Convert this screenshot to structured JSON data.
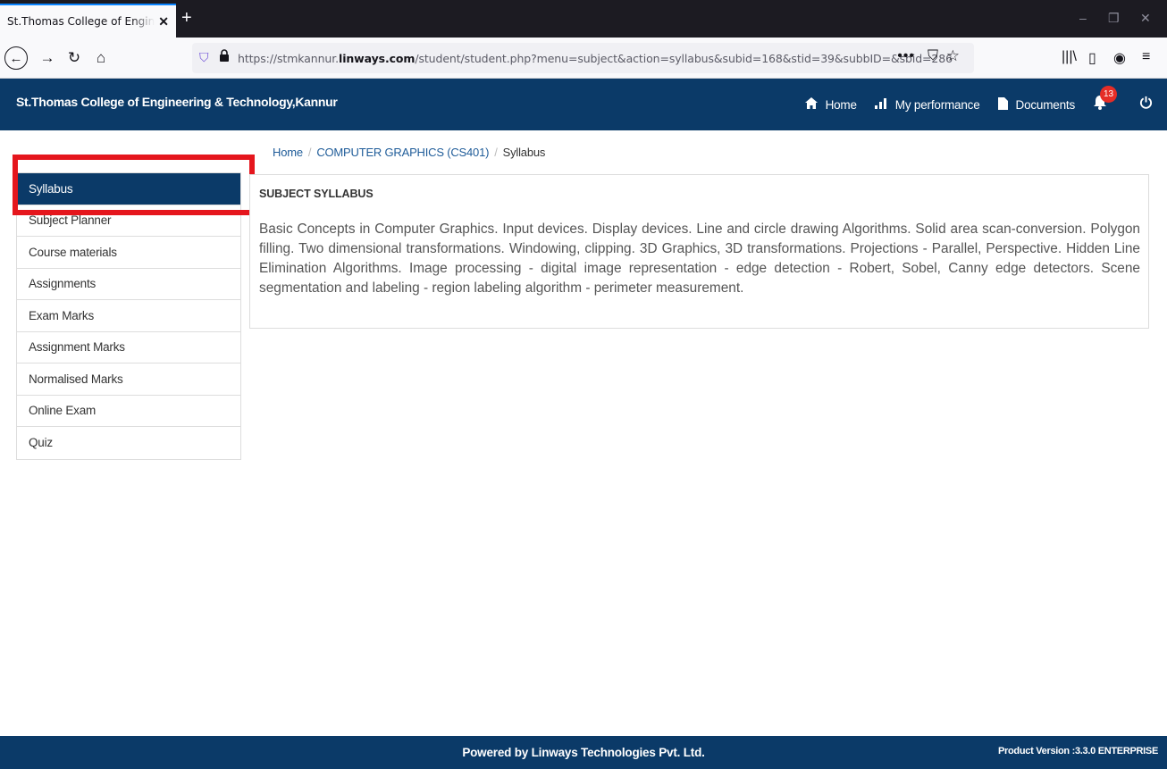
{
  "browser": {
    "tab_title": "St.Thomas College of Engineering & Technology,Kannur",
    "tab_close": "✕",
    "new_tab": "+",
    "url_prefix": "https://stmkannur.",
    "url_domain": "linways.com",
    "url_suffix": "/student/student.php?menu=subject&action=syllabus&subid=168&stid=39&subbID=&sbid=286",
    "icons": [
      "back-icon",
      "forward-icon",
      "reload-icon",
      "home-icon",
      "shield-icon",
      "lock-icon",
      "more-icon",
      "pocket-icon",
      "star-icon",
      "library-icon",
      "sidebar-icon",
      "account-icon",
      "menu-icon"
    ]
  },
  "header": {
    "title": "St.Thomas College of Engineering & Technology,Kannur",
    "links": {
      "home": "Home",
      "performance": "My performance",
      "documents": "Documents"
    },
    "notification_count": "13",
    "colors": {
      "bar": "#0b3a68",
      "badge": "#e52d27"
    }
  },
  "breadcrumb": {
    "home": "Home",
    "subject": "COMPUTER GRAPHICS (CS401)",
    "current": "Syllabus",
    "separator": "/"
  },
  "sidebar": {
    "items": [
      {
        "label": "Syllabus",
        "active": true
      },
      {
        "label": "Subject Planner"
      },
      {
        "label": "Course materials"
      },
      {
        "label": "Assignments"
      },
      {
        "label": "Exam Marks"
      },
      {
        "label": "Assignment Marks"
      },
      {
        "label": "Normalised Marks"
      },
      {
        "label": "Online Exam"
      },
      {
        "label": "Quiz"
      }
    ]
  },
  "panel": {
    "heading": "SUBJECT SYLLABUS",
    "body": "Basic Concepts in Computer Graphics. Input devices. Display devices. Line and circle drawing Algorithms. Solid area scan-conversion. Polygon filling. Two dimensional transformations. Windowing, clipping. 3D Graphics, 3D transformations. Projections - Parallel, Perspective. Hidden Line Elimination Algorithms. Image processing - digital image representation - edge detection - Robert, Sobel, Canny edge detectors. Scene segmentation and labeling - region labeling algorithm - perimeter measurement."
  },
  "footer": {
    "powered_by": "Powered by Linways Technologies Pvt. Ltd.",
    "version": "Product Version :3.3.0 ENTERPRISE"
  }
}
